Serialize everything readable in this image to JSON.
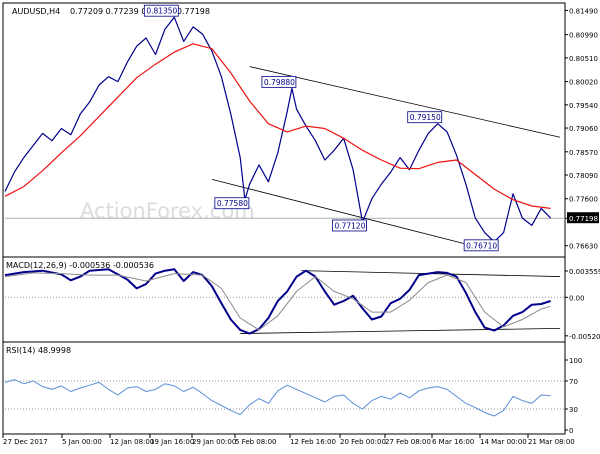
{
  "header": {
    "symbol": "AUDUSD,H4",
    "ohlc": "0.77209 0.77239 0.77160 0.77198"
  },
  "watermark": "ActionForex.com",
  "colors": {
    "price_line": "#00008b",
    "moving_average": "#ee1111",
    "channel_lines": "#000000",
    "macd_line": "#00008b",
    "macd_signal": "#8a8a8a",
    "rsi_line": "#5b8fd6",
    "grid_dotted": "#9a9a9a",
    "label_border": "#00008b",
    "current_price_box": "#000000"
  },
  "x_axis_labels": [
    "27 Dec 2017",
    "5 Jan 00:00",
    "12 Jan 08:00",
    "19 Jan 16:00",
    "29 Jan 00:00",
    "5 Feb 08:00",
    "12 Feb 16:00",
    "20 Feb 00:00",
    "27 Feb 08:00",
    "6 Mar 16:00",
    "14 Mar 00:00",
    "21 Mar 08:00"
  ],
  "chart_data": [
    {
      "panel": "price",
      "type": "line",
      "title": "AUDUSD,H4",
      "y_axis_ticks": [
        "0.81490",
        "0.80990",
        "0.80510",
        "0.80020",
        "0.79540",
        "0.79060",
        "0.78570",
        "0.78090",
        "0.77600",
        "0.77198",
        "0.76630"
      ],
      "ylim": [
        0.765,
        0.8154
      ],
      "current_price": "0.77198",
      "annotations": [
        {
          "label": "0.81350",
          "x": 36.0,
          "value": 0.8135
        },
        {
          "label": "0.77580",
          "x": 51.0,
          "value": 0.7758
        },
        {
          "label": "0.79880",
          "x": 61.0,
          "value": 0.7988
        },
        {
          "label": "0.77120",
          "x": 76.0,
          "value": 0.7712
        },
        {
          "label": "0.79150",
          "x": 92.0,
          "value": 0.7915
        },
        {
          "label": "0.76710",
          "x": 104.0,
          "value": 0.7671
        }
      ],
      "upper_channel": [
        [
          52,
          0.8033
        ],
        [
          118,
          0.7887
        ]
      ],
      "lower_channel": [
        [
          44,
          0.78
        ],
        [
          99,
          0.7664
        ]
      ],
      "series": [
        {
          "key": "price",
          "values": [
            [
              0,
              0.7775
            ],
            [
              2,
              0.7815
            ],
            [
              4,
              0.7845
            ],
            [
              6,
              0.787
            ],
            [
              8,
              0.7895
            ],
            [
              10,
              0.788
            ],
            [
              12,
              0.7905
            ],
            [
              14,
              0.7892
            ],
            [
              16,
              0.7935
            ],
            [
              18,
              0.796
            ],
            [
              20,
              0.7995
            ],
            [
              22,
              0.8012
            ],
            [
              24,
              0.8002
            ],
            [
              26,
              0.8042
            ],
            [
              28,
              0.8075
            ],
            [
              30,
              0.8092
            ],
            [
              32,
              0.8058
            ],
            [
              34,
              0.811
            ],
            [
              36,
              0.8135
            ],
            [
              38,
              0.8085
            ],
            [
              40,
              0.8115
            ],
            [
              42,
              0.81
            ],
            [
              44,
              0.8065
            ],
            [
              46,
              0.8012
            ],
            [
              48,
              0.7935
            ],
            [
              50,
              0.7845
            ],
            [
              51,
              0.7758
            ],
            [
              52,
              0.779
            ],
            [
              54,
              0.783
            ],
            [
              56,
              0.7795
            ],
            [
              58,
              0.7855
            ],
            [
              60,
              0.794
            ],
            [
              61,
              0.7988
            ],
            [
              62,
              0.7945
            ],
            [
              64,
              0.791
            ],
            [
              66,
              0.788
            ],
            [
              68,
              0.784
            ],
            [
              70,
              0.786
            ],
            [
              72,
              0.7885
            ],
            [
              74,
              0.782
            ],
            [
              76,
              0.7712
            ],
            [
              78,
              0.776
            ],
            [
              80,
              0.779
            ],
            [
              82,
              0.7815
            ],
            [
              84,
              0.7845
            ],
            [
              86,
              0.782
            ],
            [
              88,
              0.786
            ],
            [
              90,
              0.7895
            ],
            [
              92,
              0.7915
            ],
            [
              94,
              0.7898
            ],
            [
              96,
              0.785
            ],
            [
              98,
              0.779
            ],
            [
              100,
              0.772
            ],
            [
              102,
              0.769
            ],
            [
              104,
              0.7671
            ],
            [
              106,
              0.769
            ],
            [
              108,
              0.777
            ],
            [
              110,
              0.772
            ],
            [
              112,
              0.7705
            ],
            [
              114,
              0.774
            ],
            [
              116,
              0.772
            ]
          ]
        },
        {
          "key": "moving_average",
          "values": [
            [
              0,
              0.7765
            ],
            [
              4,
              0.7785
            ],
            [
              8,
              0.7818
            ],
            [
              12,
              0.7855
            ],
            [
              16,
              0.789
            ],
            [
              20,
              0.793
            ],
            [
              24,
              0.797
            ],
            [
              28,
              0.801
            ],
            [
              32,
              0.8038
            ],
            [
              36,
              0.8063
            ],
            [
              40,
              0.808
            ],
            [
              44,
              0.807
            ],
            [
              48,
              0.802
            ],
            [
              52,
              0.7962
            ],
            [
              56,
              0.7915
            ],
            [
              60,
              0.7898
            ],
            [
              64,
              0.791
            ],
            [
              68,
              0.7905
            ],
            [
              72,
              0.7885
            ],
            [
              76,
              0.786
            ],
            [
              80,
              0.784
            ],
            [
              84,
              0.7823
            ],
            [
              88,
              0.7822
            ],
            [
              92,
              0.7835
            ],
            [
              96,
              0.784
            ],
            [
              100,
              0.781
            ],
            [
              104,
              0.778
            ],
            [
              108,
              0.7758
            ],
            [
              112,
              0.7745
            ],
            [
              116,
              0.774
            ]
          ]
        }
      ]
    },
    {
      "panel": "macd",
      "type": "line",
      "title": "MACD(12,26,9) -0.000536 -0.000536",
      "y_axis_ticks": [
        "0.003559",
        "0.00",
        "-0.005207"
      ],
      "ylim": [
        -0.0055,
        0.0045
      ],
      "upper_trendline": [
        [
          63,
          0.0036
        ],
        [
          118,
          0.0028
        ]
      ],
      "lower_trendline": [
        [
          50,
          -0.0049
        ],
        [
          118,
          -0.0042
        ]
      ],
      "series": [
        {
          "key": "macd",
          "values": [
            [
              0,
              0.003
            ],
            [
              4,
              0.0034
            ],
            [
              8,
              0.0036
            ],
            [
              12,
              0.0031
            ],
            [
              14,
              0.0023
            ],
            [
              16,
              0.0028
            ],
            [
              18,
              0.0036
            ],
            [
              22,
              0.0038
            ],
            [
              26,
              0.0024
            ],
            [
              28,
              0.0012
            ],
            [
              30,
              0.0018
            ],
            [
              32,
              0.0032
            ],
            [
              34,
              0.0036
            ],
            [
              36,
              0.0038
            ],
            [
              38,
              0.0022
            ],
            [
              40,
              0.0034
            ],
            [
              42,
              0.003
            ],
            [
              44,
              0.0015
            ],
            [
              46,
              -0.0008
            ],
            [
              48,
              -0.003
            ],
            [
              50,
              -0.0044
            ],
            [
              52,
              -0.0049
            ],
            [
              54,
              -0.0043
            ],
            [
              56,
              -0.0028
            ],
            [
              58,
              -0.0005
            ],
            [
              60,
              0.0008
            ],
            [
              62,
              0.0028
            ],
            [
              64,
              0.0036
            ],
            [
              66,
              0.0028
            ],
            [
              68,
              0.0008
            ],
            [
              70,
              -0.001
            ],
            [
              72,
              -0.0005
            ],
            [
              74,
              0.0002
            ],
            [
              76,
              -0.0015
            ],
            [
              78,
              -0.003
            ],
            [
              80,
              -0.0026
            ],
            [
              82,
              -0.0008
            ],
            [
              84,
              -0.0002
            ],
            [
              86,
              0.001
            ],
            [
              88,
              0.003
            ],
            [
              90,
              0.0032
            ],
            [
              92,
              0.0034
            ],
            [
              94,
              0.0033
            ],
            [
              96,
              0.0028
            ],
            [
              98,
              0.0006
            ],
            [
              100,
              -0.002
            ],
            [
              102,
              -0.0041
            ],
            [
              104,
              -0.0045
            ],
            [
              106,
              -0.0038
            ],
            [
              108,
              -0.0025
            ],
            [
              110,
              -0.002
            ],
            [
              112,
              -0.001
            ],
            [
              114,
              -0.0009
            ],
            [
              116,
              -0.0005
            ]
          ]
        },
        {
          "key": "signal",
          "values": [
            [
              0,
              0.0028
            ],
            [
              6,
              0.0033
            ],
            [
              12,
              0.0032
            ],
            [
              18,
              0.003
            ],
            [
              24,
              0.003
            ],
            [
              30,
              0.0022
            ],
            [
              36,
              0.0032
            ],
            [
              42,
              0.003
            ],
            [
              46,
              0.0012
            ],
            [
              50,
              -0.0028
            ],
            [
              54,
              -0.0044
            ],
            [
              58,
              -0.0025
            ],
            [
              62,
              0.0008
            ],
            [
              66,
              0.0028
            ],
            [
              70,
              0.0008
            ],
            [
              74,
              -0.0002
            ],
            [
              78,
              -0.002
            ],
            [
              82,
              -0.002
            ],
            [
              86,
              -0.0004
            ],
            [
              90,
              0.002
            ],
            [
              94,
              0.003
            ],
            [
              98,
              0.002
            ],
            [
              102,
              -0.002
            ],
            [
              106,
              -0.004
            ],
            [
              110,
              -0.003
            ],
            [
              114,
              -0.0016
            ],
            [
              116,
              -0.0012
            ]
          ]
        }
      ]
    },
    {
      "panel": "rsi",
      "type": "line",
      "title": "RSI(14) 48.9998",
      "y_axis_ticks": [
        "100",
        "70",
        "30",
        "0"
      ],
      "ylim": [
        0,
        100
      ],
      "series": [
        {
          "key": "rsi",
          "values": [
            [
              0,
              68
            ],
            [
              2,
              72
            ],
            [
              4,
              66
            ],
            [
              6,
              70
            ],
            [
              8,
              62
            ],
            [
              10,
              58
            ],
            [
              12,
              63
            ],
            [
              14,
              55
            ],
            [
              16,
              60
            ],
            [
              18,
              64
            ],
            [
              20,
              68
            ],
            [
              22,
              58
            ],
            [
              24,
              50
            ],
            [
              26,
              60
            ],
            [
              28,
              62
            ],
            [
              30,
              55
            ],
            [
              32,
              58
            ],
            [
              34,
              66
            ],
            [
              36,
              63
            ],
            [
              38,
              55
            ],
            [
              40,
              61
            ],
            [
              42,
              52
            ],
            [
              44,
              42
            ],
            [
              46,
              35
            ],
            [
              48,
              28
            ],
            [
              50,
              22
            ],
            [
              52,
              36
            ],
            [
              54,
              45
            ],
            [
              56,
              38
            ],
            [
              58,
              56
            ],
            [
              60,
              64
            ],
            [
              62,
              58
            ],
            [
              64,
              52
            ],
            [
              66,
              46
            ],
            [
              68,
              40
            ],
            [
              70,
              48
            ],
            [
              72,
              50
            ],
            [
              74,
              38
            ],
            [
              76,
              30
            ],
            [
              78,
              42
            ],
            [
              80,
              48
            ],
            [
              82,
              44
            ],
            [
              84,
              53
            ],
            [
              86,
              46
            ],
            [
              88,
              56
            ],
            [
              90,
              60
            ],
            [
              92,
              62
            ],
            [
              94,
              58
            ],
            [
              96,
              48
            ],
            [
              98,
              38
            ],
            [
              100,
              32
            ],
            [
              102,
              25
            ],
            [
              104,
              20
            ],
            [
              106,
              28
            ],
            [
              108,
              48
            ],
            [
              110,
              42
            ],
            [
              112,
              38
            ],
            [
              114,
              50
            ],
            [
              116,
              49
            ]
          ]
        }
      ]
    }
  ]
}
